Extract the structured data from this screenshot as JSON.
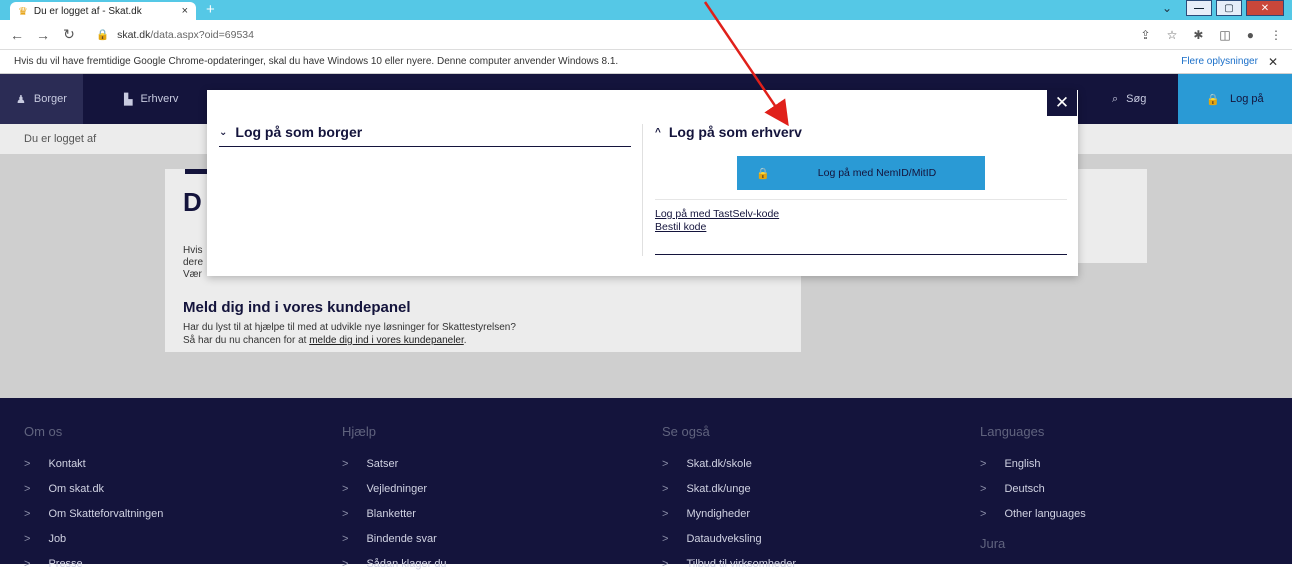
{
  "browser": {
    "tab_title": "Du er logget af - Skat.dk",
    "tab_close": "×",
    "new_tab": "+",
    "url_host": "skat.dk",
    "url_path": "/data.aspx?oid=69534",
    "win_min": "—",
    "win_max": "▢",
    "win_close": "✕"
  },
  "infobar": {
    "message": "Hvis du vil have fremtidige Google Chrome-opdateringer, skal du have Windows 10 eller nyere. Denne computer anvender Windows 8.1.",
    "more_label": "Flere oplysninger",
    "close": "✕"
  },
  "sitenav": {
    "borger": "Borger",
    "erhverv": "Erhverv",
    "search": "Søg",
    "login": "Log på"
  },
  "subbar": {
    "text": "Du er logget af"
  },
  "card": {
    "heading_fragment": "D",
    "line1": "Hvis",
    "line2": "dere",
    "line3": "Vær",
    "panel_heading": "Meld dig ind i vores kundepanel",
    "panel_text1": "Har du lyst til at hjælpe til med at udvikle nye løsninger for Skattestyrelsen?",
    "panel_text2_prefix": "Så har du nu chancen for at ",
    "panel_link": "melde dig ind i vores kundepaneler",
    "panel_text2_suffix": "."
  },
  "modal": {
    "close": "✕",
    "borger_title": "Log på som borger",
    "erhverv_title": "Log på som erhverv",
    "nemid_button": "Log på med NemID/MitID",
    "tastselv_link": "Log på med TastSelv-kode",
    "bestil_link": "Bestil kode"
  },
  "footer": {
    "columns": [
      {
        "heading": "Om os",
        "links": [
          "Kontakt",
          "Om skat.dk",
          "Om Skatteforvaltningen",
          "Job",
          "Presse"
        ]
      },
      {
        "heading": "Hjælp",
        "links": [
          "Satser",
          "Vejledninger",
          "Blanketter",
          "Bindende svar",
          "Sådan klager du"
        ]
      },
      {
        "heading": "Se også",
        "links": [
          "Skat.dk/skole",
          "Skat.dk/unge",
          "Myndigheder",
          "Dataudveksling",
          "Tilbud til virksomheder"
        ]
      },
      {
        "heading": "Languages",
        "links": [
          "English",
          "Deutsch",
          "Other languages"
        ],
        "extra": "Jura"
      }
    ]
  },
  "colors": {
    "navy": "#14143c",
    "accent": "#2a9ad5",
    "annotation": "#e0201a"
  }
}
